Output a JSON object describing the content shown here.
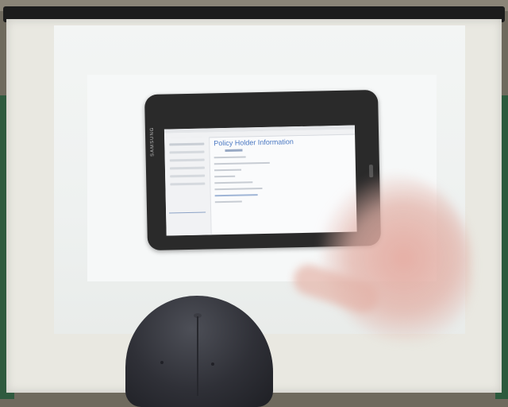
{
  "scene": {
    "description_free": true
  },
  "tablet": {
    "brand_text": "SAMSUNG",
    "url_text": "",
    "heading": "Policy Holder Information"
  },
  "colors": {
    "wall": "#2f5a3f",
    "screen": "#e9e8e1",
    "tablet_body": "#2a2a2a",
    "heading_blue": "#4a78c2",
    "cap": "#2f3037"
  }
}
